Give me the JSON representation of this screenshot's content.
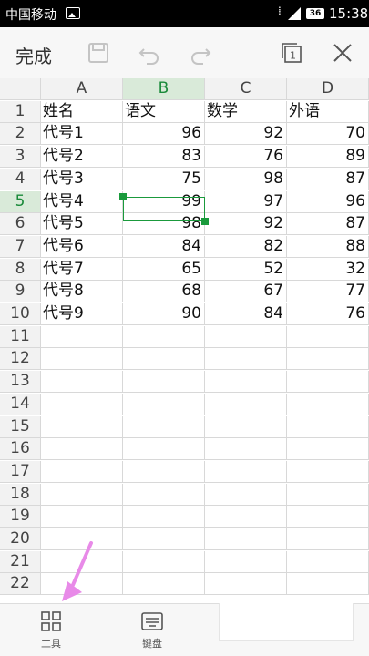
{
  "status_bar": {
    "carrier": "中国移动",
    "signal_tag": "36",
    "time": "15:38"
  },
  "toolbar": {
    "done_label": "完成"
  },
  "columns": [
    "A",
    "B",
    "C",
    "D"
  ],
  "rows": [
    {
      "num": "1",
      "a": "姓名",
      "b": "语文",
      "c": "数学",
      "d": "外语"
    },
    {
      "num": "2",
      "a": "代号1",
      "b": "96",
      "c": "92",
      "d": "70"
    },
    {
      "num": "3",
      "a": "代号2",
      "b": "83",
      "c": "76",
      "d": "89"
    },
    {
      "num": "4",
      "a": "代号3",
      "b": "75",
      "c": "98",
      "d": "87"
    },
    {
      "num": "5",
      "a": "代号4",
      "b": "99",
      "c": "97",
      "d": "96"
    },
    {
      "num": "6",
      "a": "代号5",
      "b": "98",
      "c": "92",
      "d": "87"
    },
    {
      "num": "7",
      "a": "代号6",
      "b": "84",
      "c": "82",
      "d": "88"
    },
    {
      "num": "8",
      "a": "代号7",
      "b": "65",
      "c": "52",
      "d": "32"
    },
    {
      "num": "9",
      "a": "代号8",
      "b": "68",
      "c": "67",
      "d": "77"
    },
    {
      "num": "10",
      "a": "代号9",
      "b": "90",
      "c": "84",
      "d": "76"
    },
    {
      "num": "11",
      "a": "",
      "b": "",
      "c": "",
      "d": ""
    },
    {
      "num": "12",
      "a": "",
      "b": "",
      "c": "",
      "d": ""
    },
    {
      "num": "13",
      "a": "",
      "b": "",
      "c": "",
      "d": ""
    },
    {
      "num": "14",
      "a": "",
      "b": "",
      "c": "",
      "d": ""
    },
    {
      "num": "15",
      "a": "",
      "b": "",
      "c": "",
      "d": ""
    },
    {
      "num": "16",
      "a": "",
      "b": "",
      "c": "",
      "d": ""
    },
    {
      "num": "17",
      "a": "",
      "b": "",
      "c": "",
      "d": ""
    },
    {
      "num": "18",
      "a": "",
      "b": "",
      "c": "",
      "d": ""
    },
    {
      "num": "19",
      "a": "",
      "b": "",
      "c": "",
      "d": ""
    },
    {
      "num": "20",
      "a": "",
      "b": "",
      "c": "",
      "d": ""
    },
    {
      "num": "21",
      "a": "",
      "b": "",
      "c": "",
      "d": ""
    },
    {
      "num": "22",
      "a": "",
      "b": "",
      "c": "",
      "d": ""
    }
  ],
  "selection": {
    "cell": "B5",
    "column": "B",
    "row": "5"
  },
  "bottom_bar": {
    "tools_label": "工具",
    "keyboard_label": "键盘"
  },
  "colors": {
    "accent": "#1a9a3c",
    "selected_header": "#d9ead9",
    "pointer": "#e88ae8"
  }
}
